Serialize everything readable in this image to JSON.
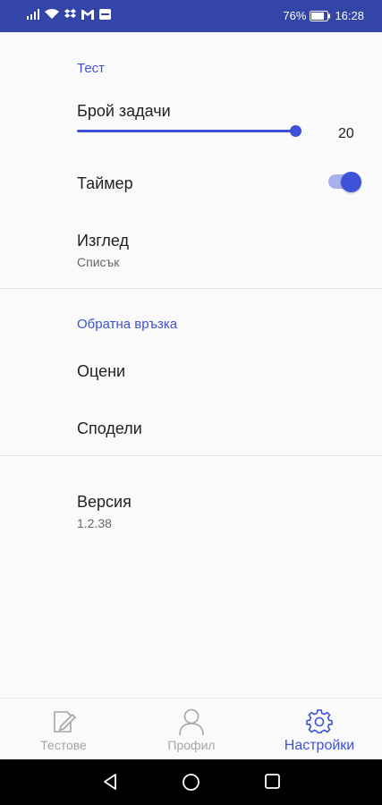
{
  "status_bar": {
    "battery": "76%",
    "time": "16:28"
  },
  "sections": {
    "test": {
      "header": "Тест",
      "task_count": {
        "label": "Брой задачи",
        "value": "20",
        "fraction": 1.0
      },
      "timer": {
        "label": "Таймер",
        "enabled": true
      },
      "view": {
        "label": "Изглед",
        "value": "Списък"
      }
    },
    "feedback": {
      "header": "Обратна връзка",
      "rate_label": "Оцени",
      "share_label": "Сподели"
    },
    "version": {
      "label": "Версия",
      "value": "1.2.38"
    }
  },
  "bottom_nav": {
    "items": [
      {
        "label": "Тестове",
        "icon": "edit-document-icon",
        "active": false
      },
      {
        "label": "Профил",
        "icon": "person-icon",
        "active": false
      },
      {
        "label": "Настройки",
        "icon": "gear-icon",
        "active": true
      }
    ]
  },
  "colors": {
    "accent": "#3f51d6",
    "status_bar": "#3346a8",
    "inactive": "#a5a5a5"
  }
}
